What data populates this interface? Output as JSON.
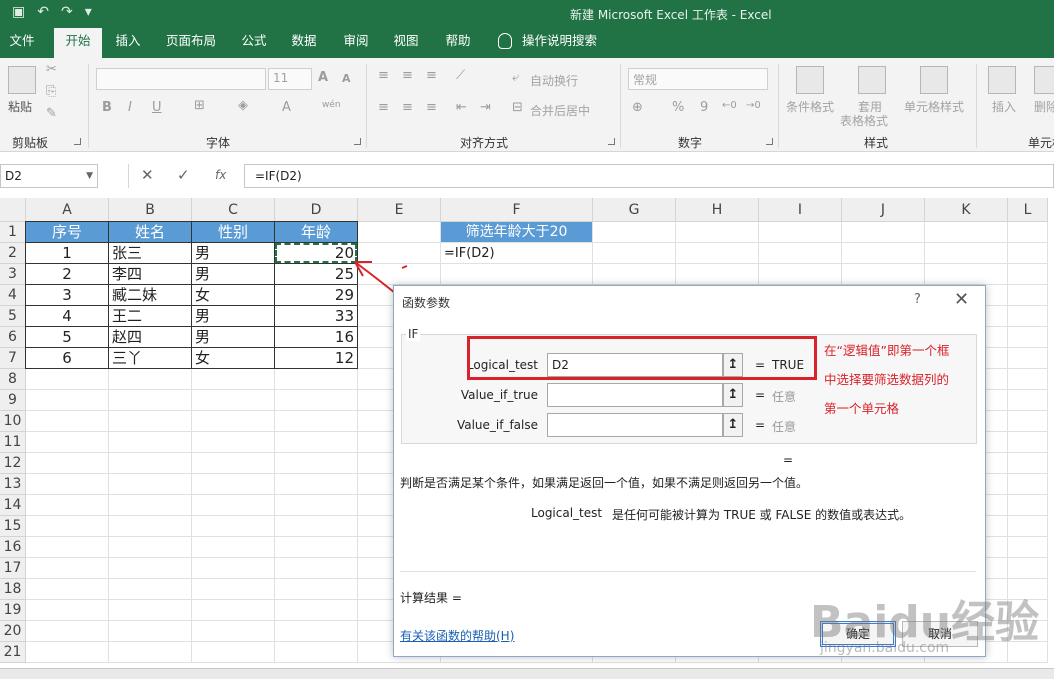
{
  "titlebar": {
    "title": "新建 Microsoft Excel 工作表  -  Excel",
    "qat_icons": [
      "save-icon",
      "undo-icon",
      "redo-icon",
      "customize-icon"
    ]
  },
  "tabs": [
    "文件",
    "开始",
    "插入",
    "页面布局",
    "公式",
    "数据",
    "审阅",
    "视图",
    "帮助"
  ],
  "active_tab": "开始",
  "tell_me": "操作说明搜索",
  "ribbon": {
    "clipboard": {
      "label": "剪贴板",
      "paste": "粘贴"
    },
    "font": {
      "label": "字体",
      "font_name": "",
      "font_size": "11",
      "bold": "B",
      "italic": "I",
      "underline": "U",
      "grow": "A",
      "shrink": "A",
      "phonetic": "wén"
    },
    "alignment": {
      "label": "对齐方式",
      "wrap": "自动换行",
      "merge": "合并后居中"
    },
    "number": {
      "label": "数字",
      "format": "常规",
      "percent": "%",
      "comma": "9"
    },
    "styles": {
      "label": "样式",
      "conditional": "条件格式",
      "table_format_1": "套用",
      "table_format_2": "表格格式",
      "cell_styles": "单元格样式"
    },
    "cells": {
      "label": "单元格",
      "insert": "插入",
      "delete": "删除"
    }
  },
  "formula_bar": {
    "name_box": "D2",
    "cancel": "✕",
    "enter": "✓",
    "fx": "fx",
    "formula": "=IF(D2)"
  },
  "columns": [
    "A",
    "B",
    "C",
    "D",
    "E",
    "F",
    "G",
    "H",
    "I",
    "J",
    "K",
    "L"
  ],
  "rows": [
    "1",
    "2",
    "3",
    "4",
    "5",
    "6",
    "7",
    "8",
    "9",
    "10",
    "11",
    "12",
    "13",
    "14",
    "15",
    "16",
    "17",
    "18",
    "19",
    "20",
    "21"
  ],
  "table": {
    "headers": [
      "序号",
      "姓名",
      "性别",
      "年龄"
    ],
    "rows": [
      [
        "1",
        "张三",
        "男",
        "20"
      ],
      [
        "2",
        "李四",
        "男",
        "25"
      ],
      [
        "3",
        "臧二妹",
        "女",
        "29"
      ],
      [
        "4",
        "王二",
        "男",
        "33"
      ],
      [
        "5",
        "赵四",
        "男",
        "16"
      ],
      [
        "6",
        "三丫",
        "女",
        "12"
      ]
    ]
  },
  "filter_header": "筛选年龄大于20",
  "filter_formula": "=IF(D2)",
  "dialog": {
    "title": "函数参数",
    "help": "?",
    "close": "✕",
    "function_name": "IF",
    "args": [
      {
        "label": "Logical_test",
        "value": "D2",
        "result": "TRUE"
      },
      {
        "label": "Value_if_true",
        "value": "",
        "result": "任意"
      },
      {
        "label": "Value_if_false",
        "value": "",
        "result": "任意"
      }
    ],
    "overall_eq": "=",
    "description": "判断是否满足某个条件，如果满足返回一个值，如果不满足则返回另一个值。",
    "param_name": "Logical_test",
    "param_desc": "是任何可能被计算为 TRUE 或 FALSE 的数值或表达式。",
    "result_label": "计算结果 =",
    "help_link": "有关该函数的帮助(H)",
    "ok": "确定",
    "cancel": "取消"
  },
  "annotation": "在“逻辑值”即第一个框中选择要筛选数据列的第一个单元格",
  "watermark": {
    "main": "Baidu经验",
    "sub": "jingyan.baidu.com"
  },
  "colors": {
    "excel_green": "#217346",
    "header_blue": "#5b9bd5",
    "annotation_red": "#d9232a"
  }
}
